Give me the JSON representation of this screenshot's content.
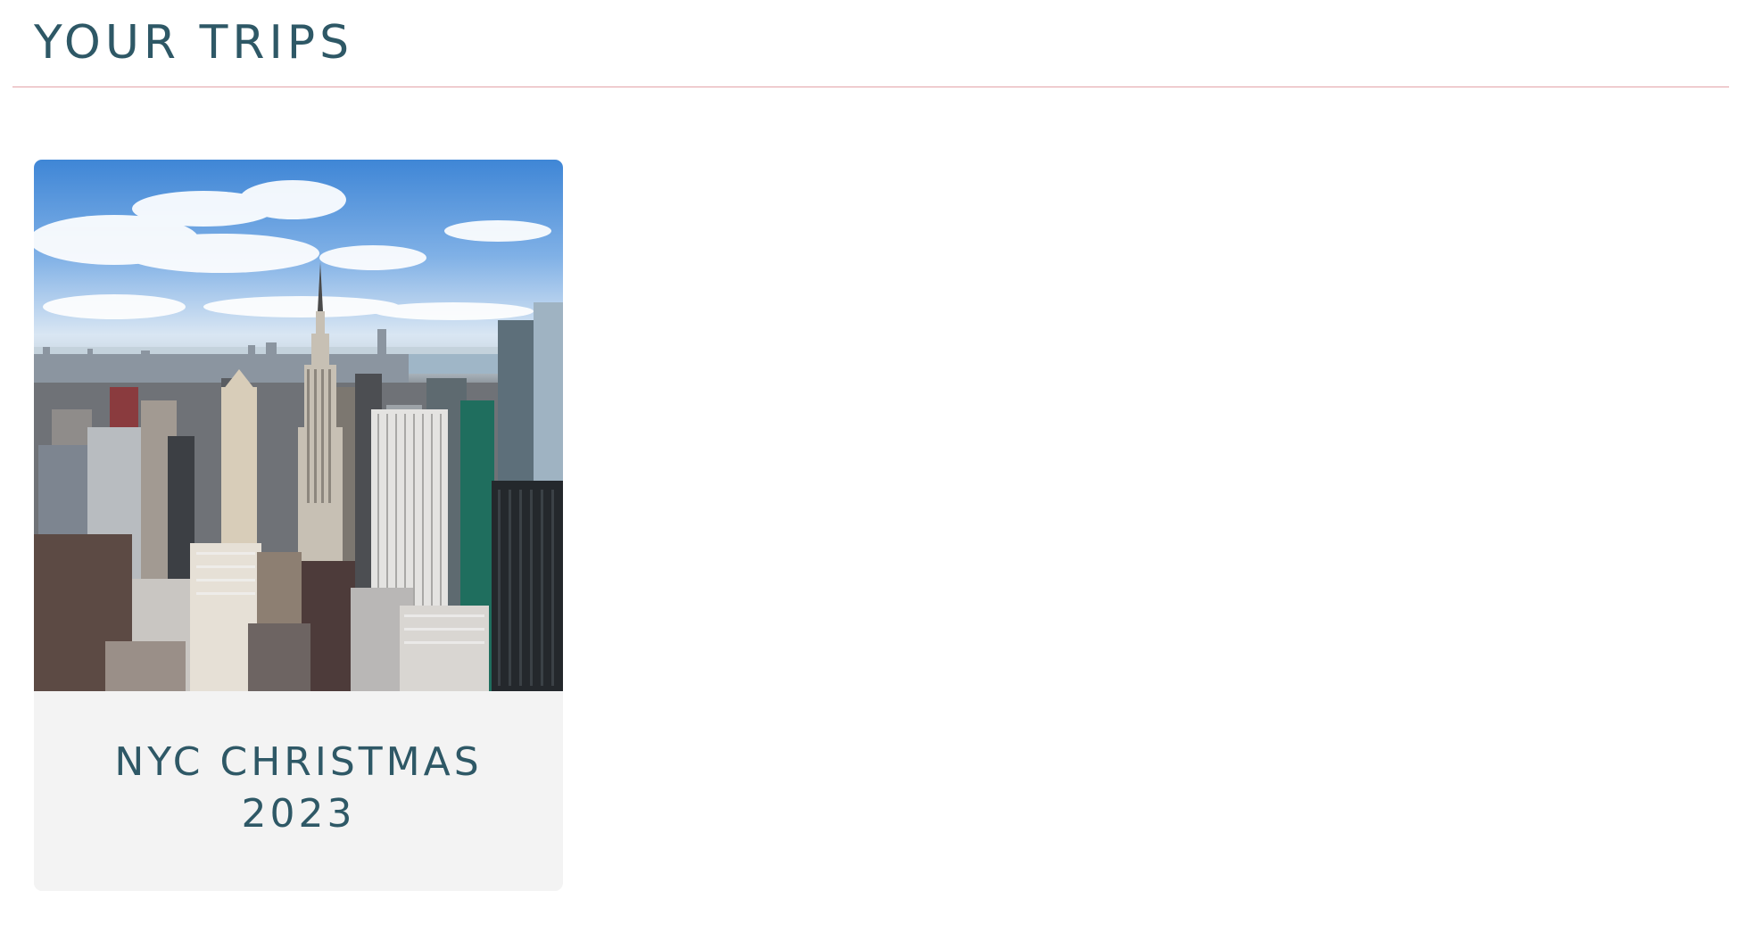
{
  "header": {
    "title": "YOUR TRIPS"
  },
  "trips": [
    {
      "title_line1": "NYC CHRISTMAS",
      "title_line2": "2023",
      "image_subject": "new-york-skyline-photo"
    }
  ],
  "colors": {
    "heading": "#2e5866",
    "divider": "#e3a3a8",
    "card_background": "#f3f3f3",
    "page_background": "#ffffff"
  }
}
